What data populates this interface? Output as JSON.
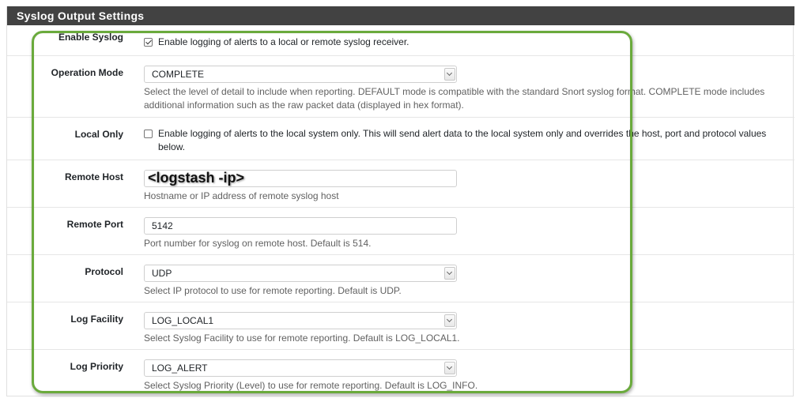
{
  "panel": {
    "title": "Syslog Output Settings"
  },
  "enable_syslog": {
    "label": "Enable Syslog",
    "checked": true,
    "text": "Enable logging of alerts to a local or remote syslog receiver."
  },
  "operation_mode": {
    "label": "Operation Mode",
    "value": "COMPLETE",
    "help": "Select the level of detail to include when reporting. DEFAULT mode is compatible with the standard Snort syslog format. COMPLETE mode includes additional information such as the raw packet data (displayed in hex format)."
  },
  "local_only": {
    "label": "Local Only",
    "checked": false,
    "text": "Enable logging of alerts to the local system only. This will send alert data to the local system only and overrides the host, port and protocol values below."
  },
  "remote_host": {
    "label": "Remote Host",
    "value": "",
    "overlay": "<logstash -ip>",
    "help": "Hostname or IP address of remote syslog host"
  },
  "remote_port": {
    "label": "Remote Port",
    "value": "5142",
    "help": "Port number for syslog on remote host. Default is 514."
  },
  "protocol": {
    "label": "Protocol",
    "value": "UDP",
    "help": "Select IP protocol to use for remote reporting. Default is UDP."
  },
  "log_facility": {
    "label": "Log Facility",
    "value": "LOG_LOCAL1",
    "help": "Select Syslog Facility to use for remote reporting. Default is LOG_LOCAL1."
  },
  "log_priority": {
    "label": "Log Priority",
    "value": "LOG_ALERT",
    "help": "Select Syslog Priority (Level) to use for remote reporting. Default is LOG_INFO."
  },
  "colors": {
    "header_bg": "#424242",
    "highlight": "#6aaa3c"
  }
}
